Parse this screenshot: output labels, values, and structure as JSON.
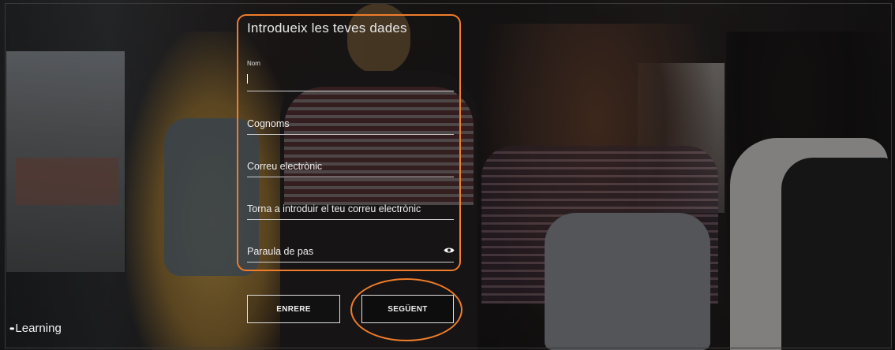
{
  "form": {
    "title": "Introdueix les teves dades",
    "name_small_label": "Nom",
    "surname_label": "Cognoms",
    "email_label": "Correu electrònic",
    "email_confirm_label": "Torna a introduir el teu correu electrònic",
    "password_label": "Paraula de pas"
  },
  "buttons": {
    "back_label": "ENRERE",
    "next_label": "SEGÜENT"
  },
  "brand": {
    "dots": "••",
    "text": "Learning"
  },
  "icons": {
    "password_toggle": "eye-icon"
  },
  "colors": {
    "highlight": "#f07d2b"
  }
}
